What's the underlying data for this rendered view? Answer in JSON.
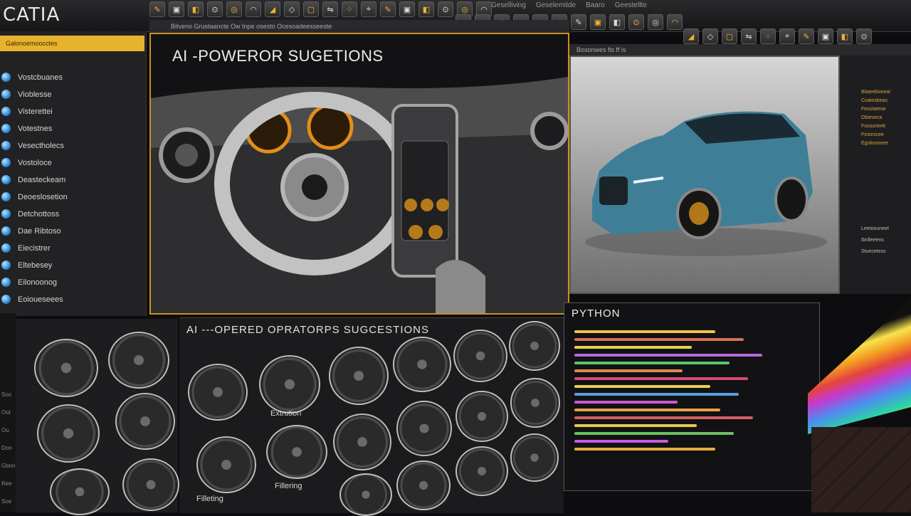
{
  "app": {
    "brand": "CATIA"
  },
  "menu": [
    "Geselliving",
    "Geselemitde",
    "Baaro",
    "Geestellte"
  ],
  "viewport_main": {
    "header": "Bitveno Grustaancte  Ow  Inpe osesto  Ocesoadeesseeste",
    "title": "AI -POWEROR SUGETIONS"
  },
  "viewport_car": {
    "header": "Bosonwes  fis  ff  is"
  },
  "sidebar": {
    "selected": "Galonoemoocctes",
    "items": [
      "Vostcbuanes",
      "Vioblesse",
      "Visterettei",
      "Votestnes",
      "Vesectholecs",
      "Vostoloce",
      "Deasteckeam",
      "Deoeslosetion",
      "Detchottoss",
      "Dae Ribtoso",
      "Eiecistrer",
      "Eltebesey",
      "Eilonoonog",
      "Eoioueseees"
    ]
  },
  "operators": {
    "title": "AI  ---OPERED OPRATORPS SUGCESTIONS",
    "labels": [
      "Extrution",
      "Filleting",
      "Fillering"
    ]
  },
  "python": {
    "title": "PYTHON"
  },
  "right_panel": {
    "items": [
      "Bitaeeboneal",
      "Coaiosbeas",
      "Fesotatese",
      "Obieveca",
      "Fossorieek",
      "Fictonicee",
      "Egsliosenee"
    ],
    "labels": [
      "Leetoouneet",
      "Ibnlleeens",
      "Stuecetess"
    ]
  },
  "left_rim": [
    "Soo",
    "Oot",
    "Ou",
    "Don",
    "Gbon",
    "Ree",
    "Soe"
  ],
  "colors": {
    "accent": "#e7b22d",
    "panel": "#1b1b1d",
    "viewport_border": "#c9921a"
  },
  "toolbar_icons": [
    "sketch-icon",
    "pad-icon",
    "pocket-icon",
    "shaft-icon",
    "hole-icon",
    "fillet-icon",
    "chamfer-icon",
    "draft-icon",
    "shell-icon",
    "mirror-icon",
    "pattern-icon",
    "measure-icon"
  ]
}
